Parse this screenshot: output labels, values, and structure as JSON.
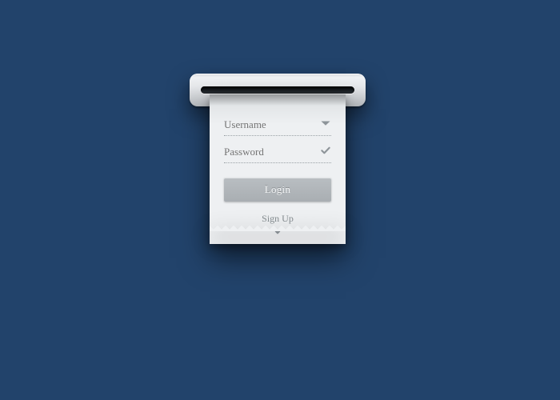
{
  "form": {
    "username": {
      "placeholder": "Username",
      "value": ""
    },
    "password": {
      "placeholder": "Password",
      "value": ""
    },
    "login_label": "Login",
    "signup_label": "Sign Up"
  },
  "icons": {
    "username_field": "caret-down-icon",
    "password_field": "check-icon",
    "signup_arrow": "chevron-down-icon"
  },
  "colors": {
    "background": "#22436b",
    "paper": "#eef0f2",
    "button": "#b0b5b9",
    "text_muted": "#7e868b"
  }
}
